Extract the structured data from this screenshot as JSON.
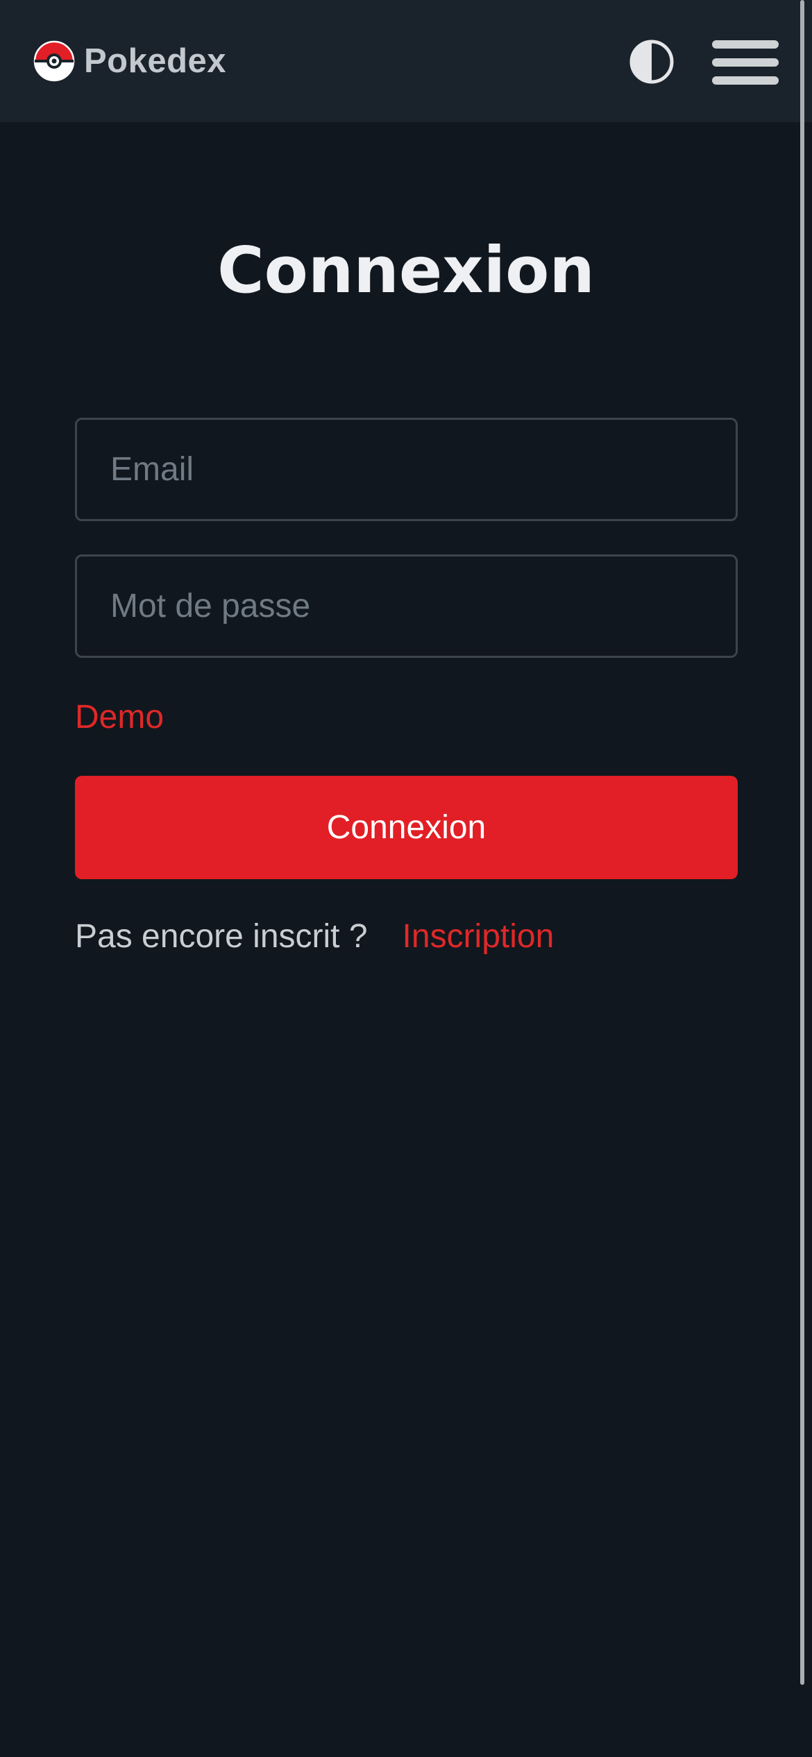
{
  "navbar": {
    "brand_name": "Pokedex",
    "logo_icon": "pokeball-icon",
    "theme_toggle_icon": "contrast-icon",
    "menu_icon": "hamburger-menu-icon"
  },
  "login": {
    "title": "Connexion",
    "email_placeholder": "Email",
    "email_value": "",
    "password_placeholder": "Mot de passe",
    "password_value": "",
    "demo_link": "Demo",
    "submit_label": "Connexion",
    "signup_prompt": "Pas encore inscrit ?",
    "signup_link": "Inscription"
  },
  "colors": {
    "background": "#11171e",
    "navbar": "#1a232b",
    "accent": "#e21f26",
    "link": "#df2828"
  }
}
